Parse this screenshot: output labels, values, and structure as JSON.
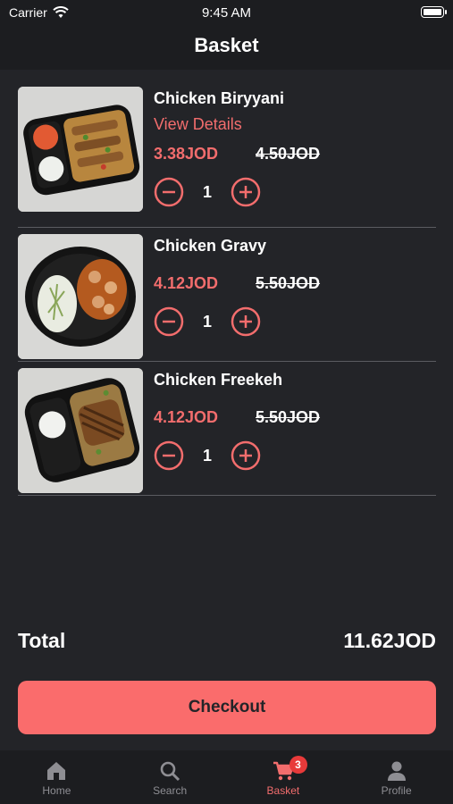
{
  "status_bar": {
    "carrier": "Carrier",
    "time": "9:45 AM"
  },
  "header": {
    "title": "Basket"
  },
  "items": [
    {
      "name": "Chicken Biryyani",
      "details_link": "View Details",
      "price": "3.38JOD",
      "original_price": "4.50JOD",
      "quantity": "1"
    },
    {
      "name": "Chicken Gravy",
      "price": "4.12JOD",
      "original_price": "5.50JOD",
      "quantity": "1"
    },
    {
      "name": "Chicken Freekeh",
      "price": "4.12JOD",
      "original_price": "5.50JOD",
      "quantity": "1"
    }
  ],
  "total": {
    "label": "Total",
    "value": "11.62JOD"
  },
  "checkout": {
    "label": "Checkout"
  },
  "tabs": [
    {
      "label": "Home",
      "icon": "home-icon"
    },
    {
      "label": "Search",
      "icon": "search-icon"
    },
    {
      "label": "Basket",
      "icon": "cart-icon",
      "badge": "3",
      "active": true
    },
    {
      "label": "Profile",
      "icon": "person-icon"
    }
  ],
  "colors": {
    "accent": "#fa6c6c",
    "background": "#232428",
    "bar": "#1c1d20",
    "badge": "#e83a3a"
  }
}
